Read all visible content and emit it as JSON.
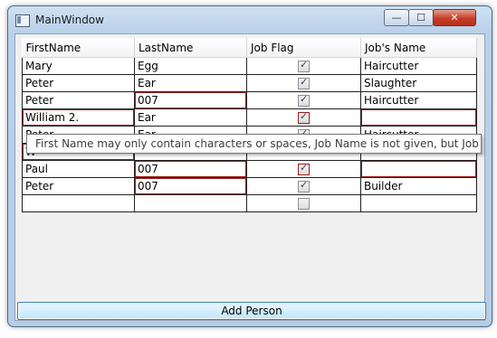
{
  "window": {
    "title": "MainWindow",
    "minimize_glyph": "—",
    "maximize_glyph": "☐",
    "close_glyph": "✕"
  },
  "grid": {
    "columns": [
      "FirstName",
      "LastName",
      "Job Flag",
      "Job's Name"
    ],
    "rows": [
      {
        "first": "Mary",
        "last": "Egg",
        "flag": true,
        "job": "Haircutter"
      },
      {
        "first": "Peter",
        "last": "Ear",
        "flag": true,
        "job": "Slaughter"
      },
      {
        "first": "Peter",
        "last": "007",
        "flag": true,
        "job": "Haircutter"
      },
      {
        "first": "William 2.",
        "last": "Ear",
        "flag": true,
        "job": ""
      },
      {
        "first": "Peter",
        "last": "Ear",
        "flag": true,
        "job": "Haircutter"
      },
      {
        "first": "W",
        "last": "",
        "flag": false,
        "job": ""
      },
      {
        "first": "Paul",
        "last": "007",
        "flag": true,
        "job": ""
      },
      {
        "first": "Peter",
        "last": "007",
        "flag": true,
        "job": "Builder"
      },
      {
        "first": "",
        "last": "",
        "flag": false,
        "job": ""
      }
    ]
  },
  "tooltip": "First Name may only contain characters or spaces, Job Name is not given, but Job Flag is set!",
  "add_button": "Add Person",
  "colors": {
    "error_border": "#9b1d1d",
    "title_bar": "#b9d0ea"
  }
}
